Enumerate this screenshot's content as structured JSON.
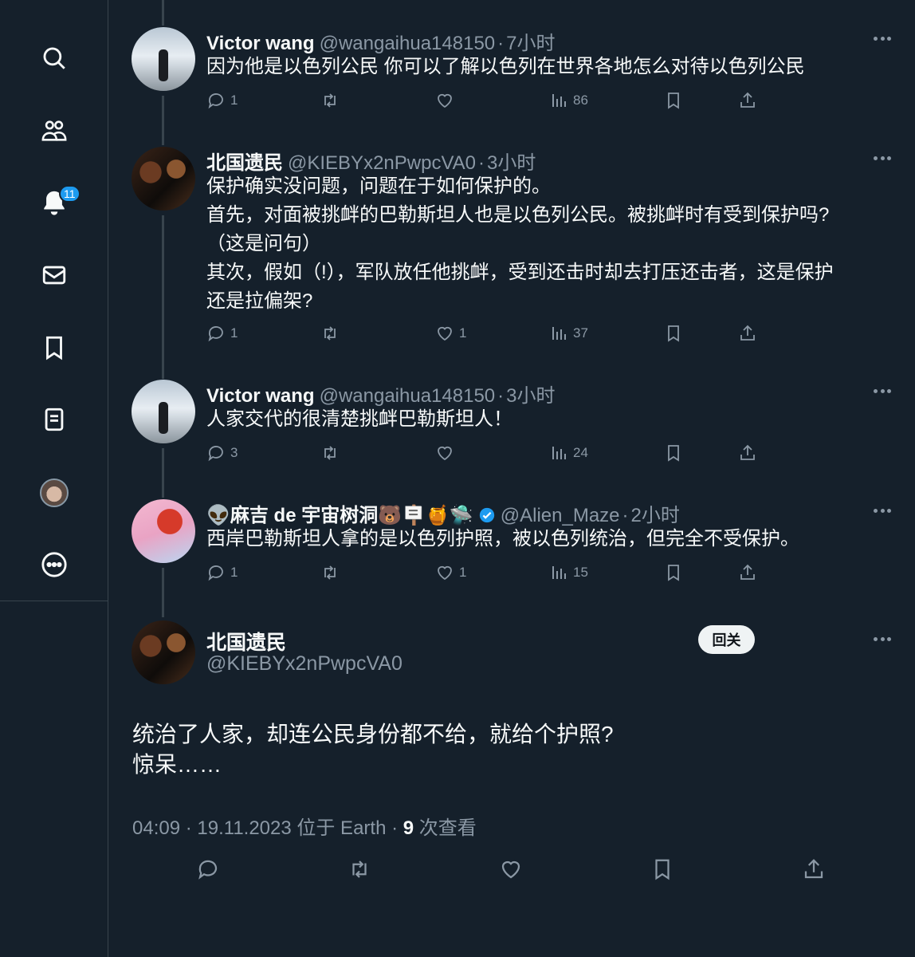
{
  "sidebar": {
    "notifications_badge": "11",
    "items": [
      {
        "name": "search-icon"
      },
      {
        "name": "communities-icon"
      },
      {
        "name": "notifications-icon"
      },
      {
        "name": "messages-icon"
      },
      {
        "name": "bookmarks-icon"
      },
      {
        "name": "lists-icon"
      },
      {
        "name": "profile-avatar"
      },
      {
        "name": "more-icon"
      }
    ]
  },
  "replies": [
    {
      "name": "Victor wang",
      "handle": "@wangaihua148150",
      "time": "7小时",
      "text": [
        "因为他是以色列公民 你可以了解以色列在世界各地怎么对待以色列公民"
      ],
      "replies": "1",
      "retweets": "",
      "likes": "",
      "views": "86"
    },
    {
      "name": "北国遗民",
      "handle": "@KIEBYx2nPwpcVA0",
      "time": "3小时",
      "text": [
        "保护确实没问题，问题在于如何保护的。",
        "首先，对面被挑衅的巴勒斯坦人也是以色列公民。被挑衅时有受到保护吗?",
        "（这是问句）",
        "其次，假如（!），军队放任他挑衅，受到还击时却去打压还击者，这是保护",
        "还是拉偏架?"
      ],
      "replies": "1",
      "retweets": "",
      "likes": "1",
      "views": "37"
    },
    {
      "name": "Victor wang",
      "handle": "@wangaihua148150",
      "time": "3小时",
      "text": [
        "人家交代的很清楚挑衅巴勒斯坦人！"
      ],
      "replies": "3",
      "retweets": "",
      "likes": "",
      "views": "24"
    },
    {
      "name": "👽麻吉 de 宇宙树洞🐻🪧🍯🛸",
      "handle": "@Alien_Maze",
      "time": "2小时",
      "text": [
        "西岸巴勒斯坦人拿的是以色列护照，被以色列统治，但完全不受保护。"
      ],
      "replies": "1",
      "retweets": "",
      "likes": "1",
      "views": "15"
    }
  ],
  "main_tweet": {
    "name": "北国遗民",
    "handle": "@KIEBYx2nPwpcVA0",
    "follow_label": "回关",
    "text": [
      "统治了人家，却连公民身份都不给，就给个护照?",
      "惊呆……"
    ],
    "meta_date": "04:09 · 19.11.2023 位于 Earth · ",
    "meta_views": "9",
    "meta_views_suffix": " 次查看"
  },
  "colors": {
    "background": "#15202b",
    "border": "#38444d",
    "muted": "#8b98a5",
    "accent": "#1d9bf0"
  }
}
